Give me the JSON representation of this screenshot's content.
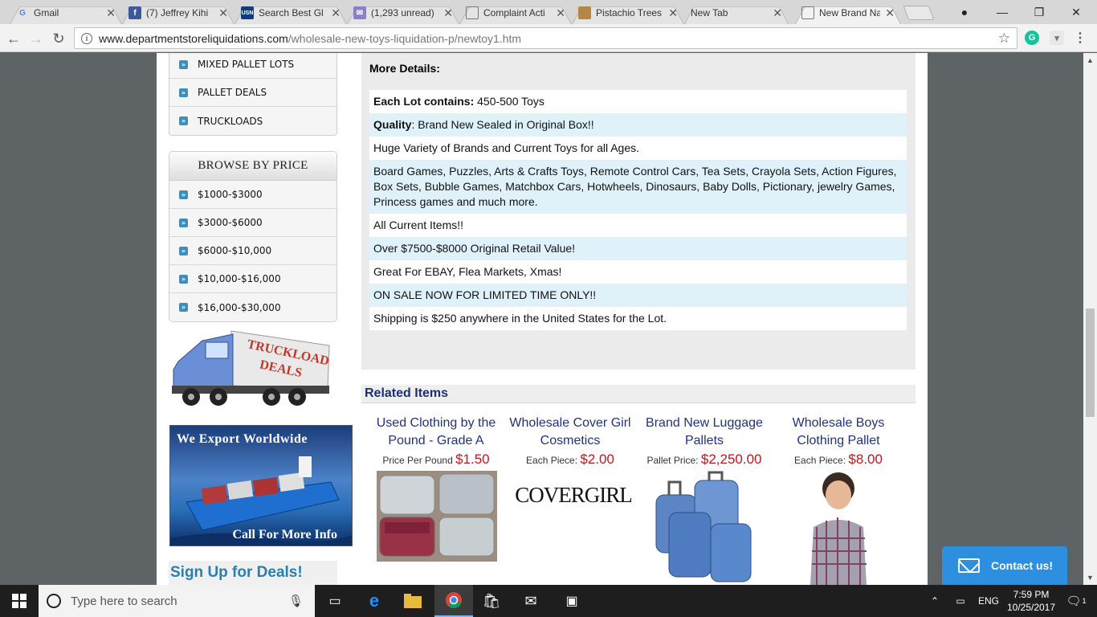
{
  "browser": {
    "tabs": [
      {
        "title": "Gmail",
        "icon": "google-icon"
      },
      {
        "title": "(7) Jeffrey Kihi",
        "icon": "facebook-icon"
      },
      {
        "title": "Search Best Gl",
        "icon": "usnews-icon"
      },
      {
        "title": "(1,293 unread)",
        "icon": "mail-icon"
      },
      {
        "title": "Complaint Acti",
        "icon": "document-icon"
      },
      {
        "title": "Pistachio Trees",
        "icon": "site-icon"
      },
      {
        "title": "New Tab",
        "icon": ""
      },
      {
        "title": "New Brand Na",
        "icon": "document-icon"
      }
    ],
    "url_domain": "www.departmentstoreliquidations.com",
    "url_path": "/wholesale-new-toys-liquidation-p/newtoy1.htm"
  },
  "sidebar": {
    "top_items": [
      "MIXED PALLET LOTS",
      "PALLET DEALS",
      "TRUCKLOADS"
    ],
    "price_heading": "BROWSE BY PRICE",
    "price_items": [
      "$1000-$3000",
      "$3000-$6000",
      "$6000-$10,000",
      "$10,000-$16,000",
      "$16,000-$30,000"
    ],
    "truck_banner_text": [
      "TRUCKLOAD",
      "DEALS"
    ],
    "export_banner": {
      "title": "We Export Worldwide",
      "cta": "Call For More Info"
    },
    "signup": "Sign Up for Deals!"
  },
  "details": {
    "heading": "More Details:",
    "rows": [
      {
        "label": "Each Lot contains:",
        "text": " 450-500 Toys"
      },
      {
        "label": "Quality",
        "text": ":  Brand New Sealed in Original Box!!"
      },
      {
        "label": "",
        "text": "Huge Variety of Brands and Current Toys for all Ages."
      },
      {
        "label": "",
        "text": "Board Games, Puzzles, Arts & Crafts Toys, Remote Control Cars, Tea Sets, Crayola Sets, Action Figures, Box Sets, Bubble Games, Matchbox Cars, Hotwheels, Dinosaurs, Baby Dolls, Pictionary, jewelry Games, Princess games and much more."
      },
      {
        "label": "",
        "text": "All Current Items!!"
      },
      {
        "label": "",
        "text": "Over $7500-$8000 Original Retail Value!"
      },
      {
        "label": "",
        "text": "Great For EBAY, Flea Markets, Xmas!"
      },
      {
        "label": "",
        "text": "ON SALE NOW FOR LIMITED TIME ONLY!!"
      },
      {
        "label": "",
        "text": "Shipping is $250 anywhere in the United States for the Lot."
      }
    ]
  },
  "related": {
    "heading": "Related Items",
    "items": [
      {
        "name": "Used Clothing by the Pound - Grade A",
        "price_label": "Price Per Pound",
        "price": "$1.50"
      },
      {
        "name": "Wholesale Cover Girl Cosmetics",
        "price_label": "Each Piece:",
        "price": "$2.00",
        "logo": "COVERGIRL"
      },
      {
        "name": "Brand New Luggage Pallets",
        "price_label": "Pallet Price:",
        "price": "$2,250.00"
      },
      {
        "name": "Wholesale Boys Clothing Pallet",
        "price_label": "Each Piece:",
        "price": "$8.00"
      }
    ]
  },
  "contact_button": "Contact us!",
  "taskbar": {
    "search_placeholder": "Type here to search",
    "language": "ENG",
    "time": "7:59 PM",
    "date": "10/25/2017",
    "notification_count": "1"
  },
  "colors": {
    "accent": "#3b8fbf",
    "price": "#c2151b",
    "link": "#20347c",
    "contact": "#2d8fe0"
  }
}
